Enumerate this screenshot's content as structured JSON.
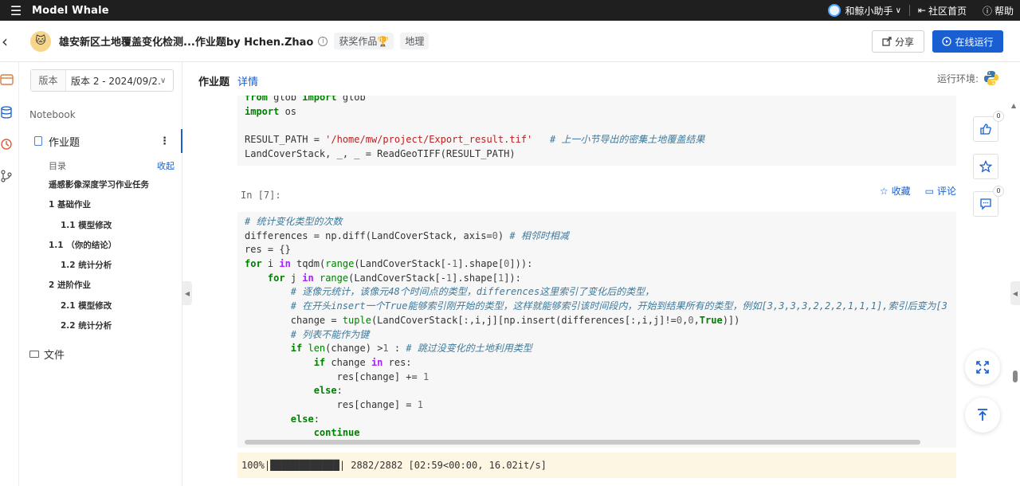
{
  "topbar": {
    "brand": "Model Whale",
    "assistant": "和鲸小助手",
    "community": "社区首页",
    "help": "帮助"
  },
  "header": {
    "title": "雄安新区土地覆盖变化检测...作业题by Hchen.Zhao",
    "tags": [
      "获奖作品🏆",
      "地理"
    ],
    "share_label": "分享",
    "run_label": "在线运行"
  },
  "sidebar": {
    "version_label": "版本",
    "version_value": "版本 2 - 2024/09/2...",
    "section": "Notebook",
    "notebook_name": "作业题",
    "toc_label": "目录",
    "collapse_label": "收起",
    "toc": [
      {
        "text": "遥感影像深度学习作业任务",
        "level": 1
      },
      {
        "text": "1 基础作业",
        "level": 1
      },
      {
        "text": "1.1 模型修改",
        "level": 2
      },
      {
        "text": "1.1 （你的结论）",
        "level": 1
      },
      {
        "text": "1.2 统计分析",
        "level": 2
      },
      {
        "text": "2 进阶作业",
        "level": 1
      },
      {
        "text": "2.1 模型修改",
        "level": 2
      },
      {
        "text": "2.2 统计分析",
        "level": 2
      }
    ],
    "files_label": "文件"
  },
  "main": {
    "tab_active": "作业题",
    "tab_detail": "详情",
    "env_label": "运行环境:",
    "cell2_prompt": "In [7]:",
    "favorite_label": "收藏",
    "comment_label": "评论",
    "output_text": "100%|████████████| 2882/2882 [02:59<00:00, 16.02it/s]"
  },
  "code1": [
    "from glob import glob",
    "import os",
    "",
    "RESULT_PATH = '/home/mw/project/Export_result.tif'   # 上一小节导出的密集土地覆盖结果",
    "LandCoverStack, _, _ = ReadGeoTIFF(RESULT_PATH)"
  ],
  "code2": [
    "# 统计变化类型的次数",
    "differences = np.diff(LandCoverStack, axis=0) # 相邻时相减",
    "res = {}",
    "for i in tqdm(range(LandCoverStack[-1].shape[0])):",
    "    for j in range(LandCoverStack[-1].shape[1]):",
    "        # 逐像元统计，该像元48个时间点的类型，differences这里索引了变化后的类型，",
    "        # 在开头insert一个True能够索引刚开始的类型，这样就能够索引该时间段内，开始到结果所有的类型，例如[3,3,3,3,2,2,2,1,1,1],索引后变为[3",
    "        change = tuple(LandCoverStack[:,i,j][np.insert(differences[:,i,j]!=0,0,True)])",
    "        # 列表不能作为键",
    "        if len(change) >1 : # 跳过没变化的土地利用类型",
    "            if change in res:",
    "                res[change] += 1",
    "            else:",
    "                res[change] = 1",
    "        else:",
    "            continue"
  ],
  "floating": {
    "like_count": "0",
    "comment_count": "0"
  },
  "colors": {
    "primary": "#1a5fd1",
    "topbar": "#1f1f1f",
    "output_bg": "#fdf6e3"
  }
}
